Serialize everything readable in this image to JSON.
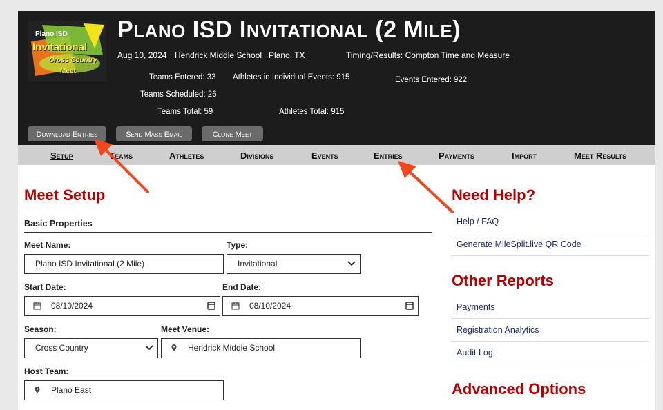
{
  "meet": {
    "title_big1": "P",
    "title_small1": "LANO",
    "title_big2": " ISD I",
    "title_small2": "NVITATIONAL",
    "title_big3": " (2 M",
    "title_small3": "ILE",
    "title_big4": ")",
    "date": "Aug 10, 2024",
    "venue": "Hendrick Middle School",
    "location": "Plano, TX",
    "timing": "Timing/Results: Compton Time and Measure",
    "teams_entered": "Teams Entered: 33",
    "athletes_individual": "Athletes in Individual Events: 915",
    "events_entered": "Events Entered: 922",
    "teams_scheduled": "Teams Scheduled: 26",
    "teams_total": "Teams Total: 59",
    "athletes_total": "Athletes Total: 915"
  },
  "logo": {
    "line1": "Plano ISD",
    "line2": "Invitational",
    "line3": "Cross Country",
    "line4": "Meet"
  },
  "header_buttons": {
    "download": "Download Entries",
    "email": "Send Mass Email",
    "clone": "Clone Meet"
  },
  "nav": [
    "Setup",
    "Teams",
    "Athletes",
    "Divisions",
    "Events",
    "Entries",
    "Payments",
    "Import",
    "Meet Results"
  ],
  "setup": {
    "heading": "Meet Setup",
    "subheading": "Basic Properties",
    "meet_name_label": "Meet Name:",
    "meet_name_value": "Plano ISD Invitational (2 Mile)",
    "type_label": "Type:",
    "type_value": "Invitational",
    "start_label": "Start Date:",
    "start_value": "08/10/2024",
    "end_label": "End Date:",
    "end_value": "08/10/2024",
    "season_label": "Season:",
    "season_value": "Cross Country",
    "venue_label": "Meet Venue:",
    "venue_value": "Hendrick Middle School",
    "host_label": "Host Team:",
    "host_value": "Plano East"
  },
  "sidebar": {
    "help_heading": "Need Help?",
    "help_links": [
      "Help / FAQ",
      "Generate MileSplit.live QR Code"
    ],
    "reports_heading": "Other Reports",
    "report_links": [
      "Payments",
      "Registration Analytics",
      "Audit Log"
    ],
    "advanced_heading": "Advanced Options"
  },
  "colors": {
    "accent": "#b30000",
    "header_bg": "#1c1c1c",
    "nav_bg": "#cfcfcf",
    "link": "#1a2a6e",
    "annotation_arrow": "#f0471e"
  }
}
